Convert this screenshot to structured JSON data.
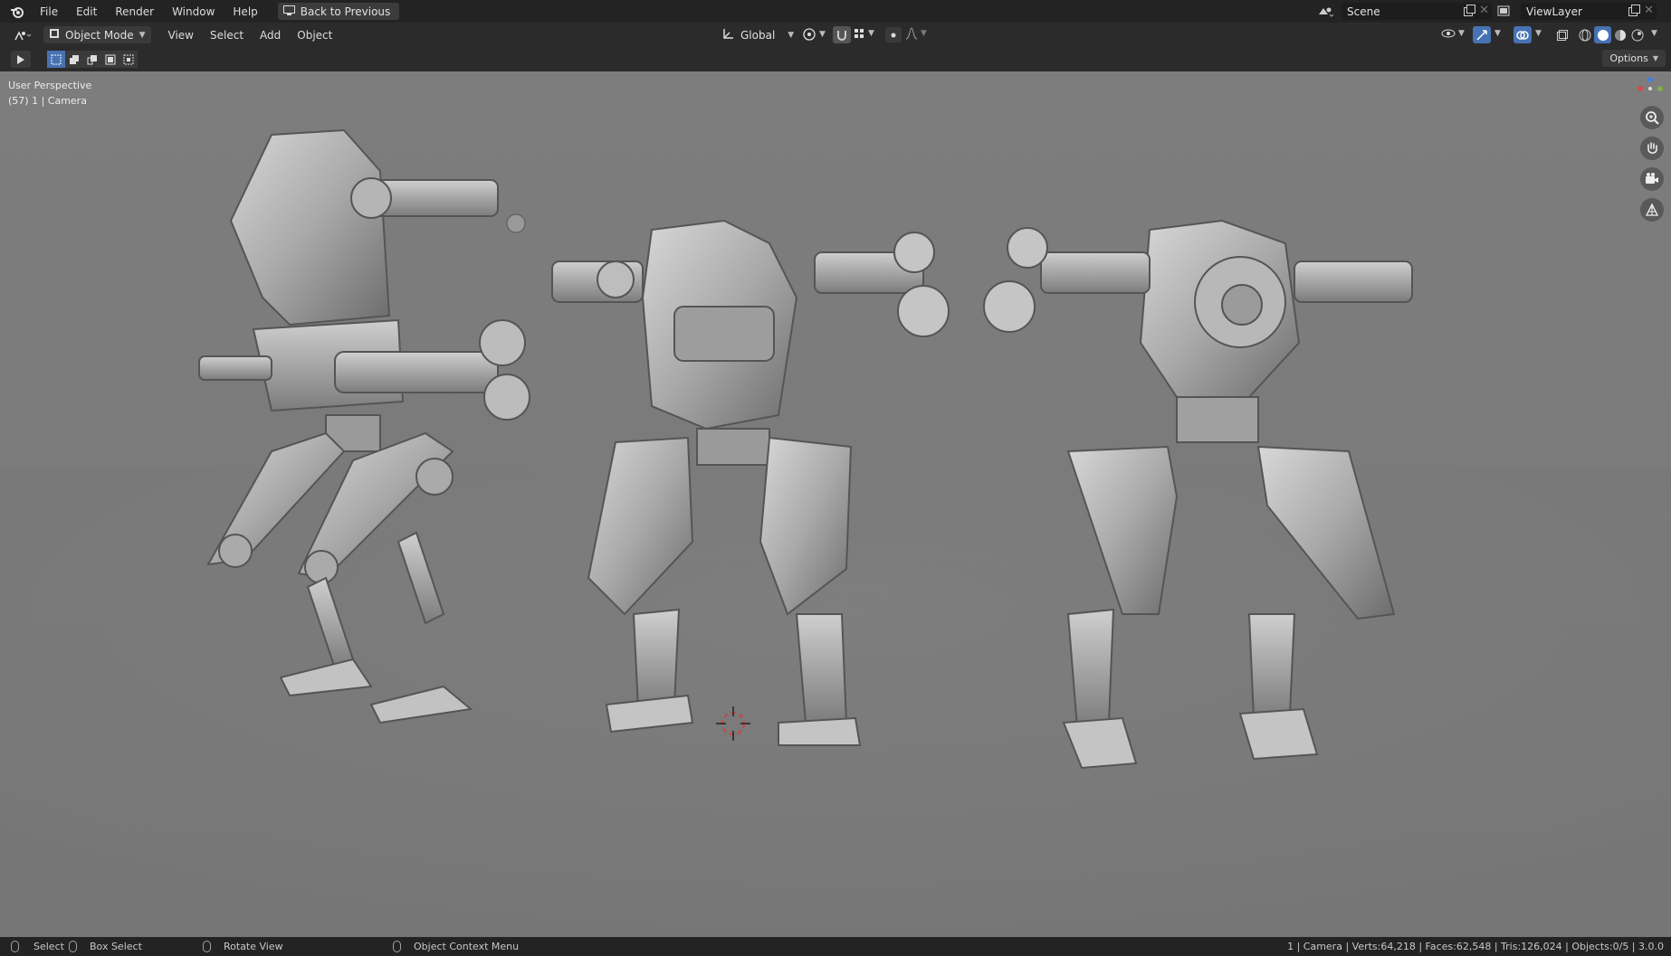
{
  "topbar": {
    "menus": [
      "File",
      "Edit",
      "Render",
      "Window",
      "Help"
    ],
    "back_button": "Back to Previous",
    "scene": "Scene",
    "view_layer": "ViewLayer"
  },
  "header": {
    "mode": "Object Mode",
    "menus": [
      "View",
      "Select",
      "Add",
      "Object"
    ],
    "transform_orientation": "Global"
  },
  "toolbar": {
    "options_label": "Options"
  },
  "viewport": {
    "perspective": "User Perspective",
    "context": "(57) 1 | Camera"
  },
  "statusbar": {
    "select": "Select",
    "box_select": "Box Select",
    "rotate_view": "Rotate View",
    "context_menu": "Object Context Menu",
    "stats": "1 | Camera | Verts:64,218 | Faces:62,548 | Tris:126,024 | Objects:0/5 | 3.0.0"
  },
  "colors": {
    "accent": "#4772b3",
    "header_bg": "#232323",
    "viewport_bg": "#7a7a7a"
  }
}
